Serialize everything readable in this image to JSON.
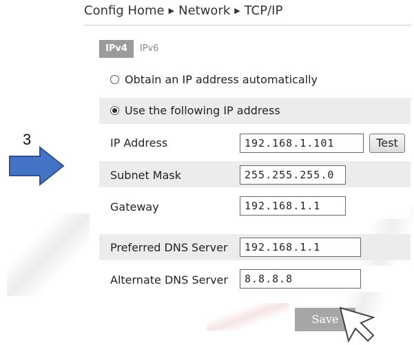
{
  "breadcrumb": {
    "home": "Config Home",
    "section": "Network",
    "page": "TCP/IP",
    "separator": "▶"
  },
  "tabs": [
    {
      "label": "IPv4",
      "active": true
    },
    {
      "label": "IPv6",
      "active": false
    }
  ],
  "ip_mode": {
    "auto_label": "Obtain an IP address automatically",
    "manual_label": "Use the following IP address",
    "selected": "manual"
  },
  "fields": {
    "ip_address": {
      "label": "IP Address",
      "value": "192.168.1.101"
    },
    "subnet_mask": {
      "label": "Subnet Mask",
      "value": "255.255.255.0"
    },
    "gateway": {
      "label": "Gateway",
      "value": "192.168.1.1"
    },
    "preferred_dns": {
      "label": "Preferred DNS Server",
      "value": "192.168.1.1"
    },
    "alternate_dns": {
      "label": "Alternate DNS Server",
      "value": "8.8.8.8"
    }
  },
  "buttons": {
    "test": "Test",
    "save": "Save"
  },
  "annotation": {
    "step_number": "3",
    "arrow_color": "#4472c4"
  },
  "colors": {
    "active_tab": "#9b9b9b",
    "row_shade": "#ececec",
    "save_button": "#a6a6a6"
  },
  "icons": {
    "annotation_arrow": "arrow-right-icon",
    "mouse_pointer": "cursor-icon"
  }
}
